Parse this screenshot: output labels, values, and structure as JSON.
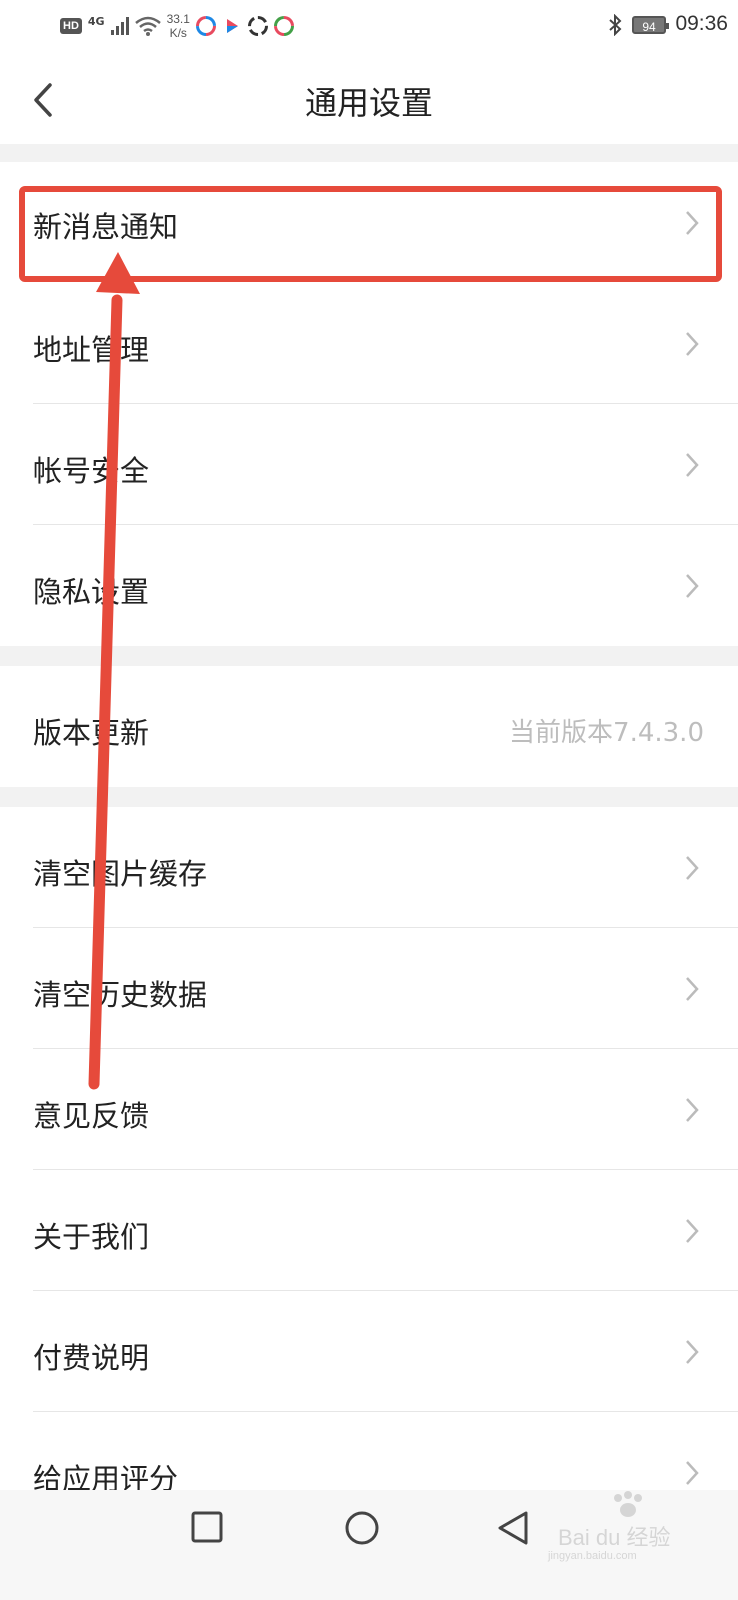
{
  "status_bar": {
    "hd": "HD",
    "network": "4G",
    "speed_value": "33.1",
    "speed_unit": "K/s",
    "battery": "94",
    "time": "09:36",
    "app_icon_colors": [
      "#e84a5f",
      "#1e88e5",
      "#333333",
      "#43a047"
    ]
  },
  "header": {
    "title": "通用设置"
  },
  "settings": {
    "group1": [
      {
        "label": "新消息通知"
      },
      {
        "label": "地址管理"
      },
      {
        "label": "帐号安全"
      },
      {
        "label": "隐私设置"
      }
    ],
    "version": {
      "label": "版本更新",
      "value": "当前版本7.4.3.0"
    },
    "group3": [
      {
        "label": "清空图片缓存"
      },
      {
        "label": "清空历史数据"
      },
      {
        "label": "意见反馈"
      },
      {
        "label": "关于我们"
      },
      {
        "label": "付费说明"
      },
      {
        "label": "给应用评分"
      }
    ]
  },
  "annotation_color": "#e64a3b",
  "watermark": {
    "text": "Bai du 经验",
    "sub": "jingyan.baidu.com"
  }
}
